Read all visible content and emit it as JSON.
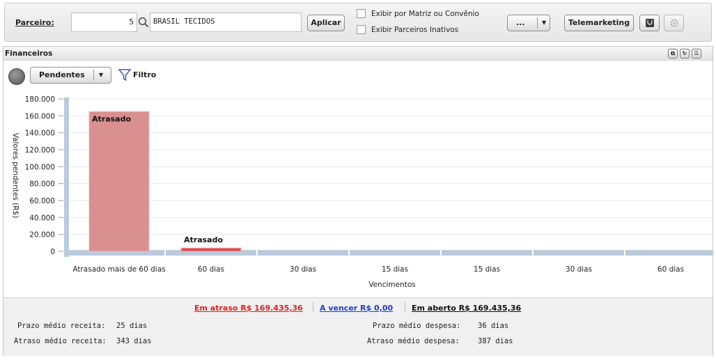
{
  "toolbar": {
    "parceiro_label": "Parceiro:",
    "parceiro_code": "5",
    "parceiro_name": "BRASIL TECIDOS",
    "aplicar_label": "Aplicar",
    "chk_matriz_label": "Exibir por Matriz ou Convênio",
    "chk_inativos_label": "Exibir Parceiros Inativos",
    "more_label": "...",
    "telemarketing_label": "Telemarketing"
  },
  "panel": {
    "title": "Financeiros",
    "filter_selected": "Pendentes",
    "filter_label": "Filtro"
  },
  "chart_data": {
    "type": "bar",
    "ylabel": "Valores pendentes (R$)",
    "xlabel": "Vencimentos",
    "ylim": [
      0,
      180000
    ],
    "yticks": [
      "0",
      "20.000",
      "40.000",
      "60.000",
      "80.000",
      "100.000",
      "120.000",
      "140.000",
      "160.000",
      "180.000"
    ],
    "categories": [
      "Atrasado mais de 60 dias",
      "60 dias",
      "30 dias",
      "15 dias",
      "15 dias",
      "30 dias",
      "60 dias"
    ],
    "values": [
      165000,
      4000,
      0,
      0,
      0,
      0,
      0
    ],
    "bar_labels": [
      "Atrasado",
      "Atrasado",
      "",
      "",
      "",
      "",
      ""
    ],
    "colors": {
      "bar": "#d9908f",
      "bar_small": "#e24a4a",
      "baseline": "#b9cbdc",
      "grid": "#e3eaf1"
    }
  },
  "summary": {
    "atraso": "Em atraso R$ 169.435,36",
    "vencer": "A vencer R$ 0,00",
    "aberto": "Em aberto R$ 169.435,36"
  },
  "stats": {
    "prazo_receita_label": "Prazo médio receita:",
    "prazo_receita_value": "25 dias",
    "atraso_receita_label": "Atraso médio receita:",
    "atraso_receita_value": "343 dias",
    "prazo_despesa_label": "Prazo médio despesa:",
    "prazo_despesa_value": "36 dias",
    "atraso_despesa_label": "Atraso médio despesa:",
    "atraso_despesa_value": "387 dias"
  },
  "colors": {
    "atraso": "#e02020",
    "vencer": "#1f3fd0"
  }
}
